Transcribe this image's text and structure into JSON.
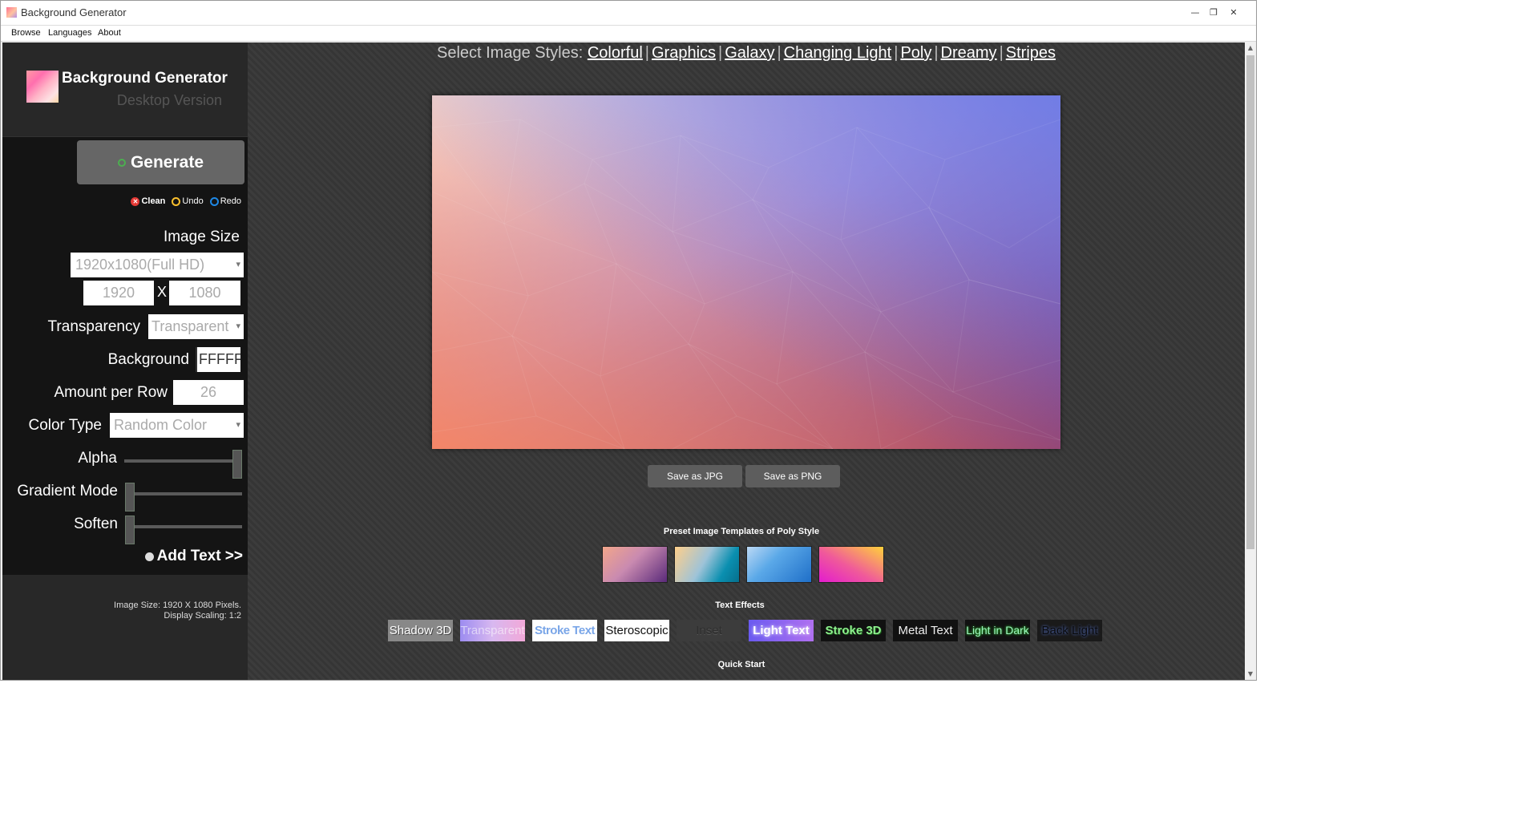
{
  "window": {
    "title": "Background Generator",
    "controls": {
      "minimize": "—",
      "restore": "❐",
      "close": "✕"
    }
  },
  "menu": {
    "items": [
      "Browse",
      "Languages",
      "About"
    ]
  },
  "sidebar": {
    "brand_title": "Background Generator",
    "brand_subtitle": "Desktop Version",
    "generate_label": "Generate",
    "actions": {
      "clean": "Clean",
      "undo": "Undo",
      "redo": "Redo"
    },
    "image_size": {
      "label": "Image Size",
      "preset": "1920x1080(Full HD)",
      "width": "1920",
      "separator": "X",
      "height": "1080"
    },
    "transparency": {
      "label": "Transparency",
      "value": "Transparent"
    },
    "background": {
      "label": "Background",
      "value": "FFFFFF"
    },
    "amount_per_row": {
      "label": "Amount per Row",
      "value": "26"
    },
    "color_type": {
      "label": "Color Type",
      "value": "Random Color"
    },
    "alpha": {
      "label": "Alpha",
      "level": 1.0
    },
    "gradient_mode": {
      "label": "Gradient Mode",
      "level": 0.0
    },
    "soften": {
      "label": "Soften",
      "level": 0.0
    },
    "add_text_label": "Add Text >>",
    "footer": {
      "line1": "Image Size: 1920 X 1080 Pixels.",
      "line2": "Display Scaling: 1:2"
    }
  },
  "main": {
    "styles_prefix": "Select Image Styles:",
    "styles": [
      "Colorful",
      "Graphics",
      "Galaxy",
      "Changing Light",
      "Poly",
      "Dreamy",
      "Stripes"
    ],
    "save_jpg": "Save as JPG",
    "save_png": "Save as PNG",
    "templates_title": "Preset Image Templates of Poly Style",
    "text_effects_title": "Text Effects",
    "text_effects": [
      "Shadow 3D",
      "Transparent",
      "Stroke Text",
      "Steroscopic",
      "Inset",
      "Light Text",
      "Stroke 3D",
      "Metal Text",
      "Light in Dark",
      "Back Light"
    ],
    "quick_start_title": "Quick Start"
  },
  "colors": {
    "sidebar_bg": "#141414",
    "sidebar_panel": "#282828",
    "main_bg": "#3c3c3c",
    "button_bg": "#666666",
    "clean_red": "#e53935",
    "undo_yellow": "#fbc02d",
    "redo_blue": "#1e88e5"
  }
}
